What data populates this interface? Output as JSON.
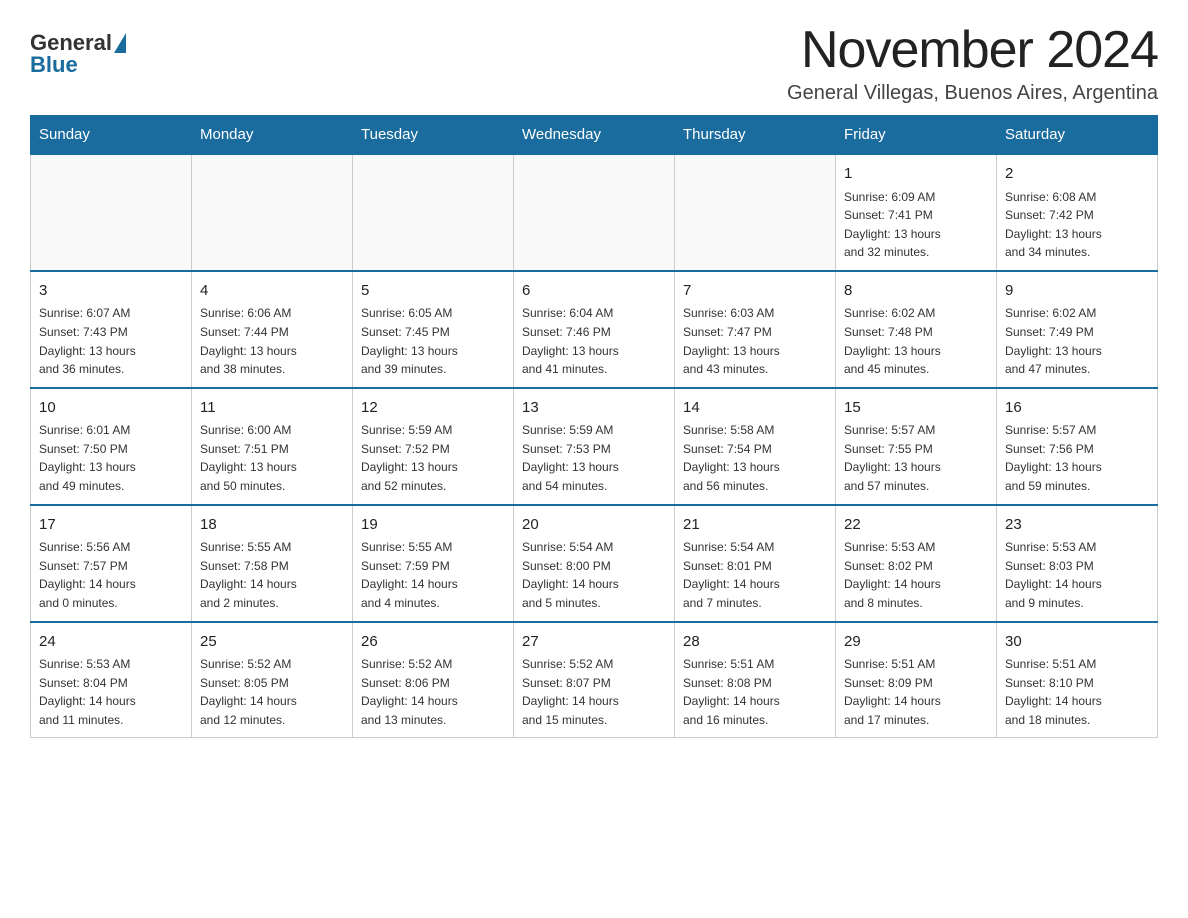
{
  "header": {
    "logo_general": "General",
    "logo_blue": "Blue",
    "main_title": "November 2024",
    "subtitle": "General Villegas, Buenos Aires, Argentina"
  },
  "days_of_week": [
    "Sunday",
    "Monday",
    "Tuesday",
    "Wednesday",
    "Thursday",
    "Friday",
    "Saturday"
  ],
  "weeks": [
    [
      {
        "day": "",
        "info": ""
      },
      {
        "day": "",
        "info": ""
      },
      {
        "day": "",
        "info": ""
      },
      {
        "day": "",
        "info": ""
      },
      {
        "day": "",
        "info": ""
      },
      {
        "day": "1",
        "info": "Sunrise: 6:09 AM\nSunset: 7:41 PM\nDaylight: 13 hours\nand 32 minutes."
      },
      {
        "day": "2",
        "info": "Sunrise: 6:08 AM\nSunset: 7:42 PM\nDaylight: 13 hours\nand 34 minutes."
      }
    ],
    [
      {
        "day": "3",
        "info": "Sunrise: 6:07 AM\nSunset: 7:43 PM\nDaylight: 13 hours\nand 36 minutes."
      },
      {
        "day": "4",
        "info": "Sunrise: 6:06 AM\nSunset: 7:44 PM\nDaylight: 13 hours\nand 38 minutes."
      },
      {
        "day": "5",
        "info": "Sunrise: 6:05 AM\nSunset: 7:45 PM\nDaylight: 13 hours\nand 39 minutes."
      },
      {
        "day": "6",
        "info": "Sunrise: 6:04 AM\nSunset: 7:46 PM\nDaylight: 13 hours\nand 41 minutes."
      },
      {
        "day": "7",
        "info": "Sunrise: 6:03 AM\nSunset: 7:47 PM\nDaylight: 13 hours\nand 43 minutes."
      },
      {
        "day": "8",
        "info": "Sunrise: 6:02 AM\nSunset: 7:48 PM\nDaylight: 13 hours\nand 45 minutes."
      },
      {
        "day": "9",
        "info": "Sunrise: 6:02 AM\nSunset: 7:49 PM\nDaylight: 13 hours\nand 47 minutes."
      }
    ],
    [
      {
        "day": "10",
        "info": "Sunrise: 6:01 AM\nSunset: 7:50 PM\nDaylight: 13 hours\nand 49 minutes."
      },
      {
        "day": "11",
        "info": "Sunrise: 6:00 AM\nSunset: 7:51 PM\nDaylight: 13 hours\nand 50 minutes."
      },
      {
        "day": "12",
        "info": "Sunrise: 5:59 AM\nSunset: 7:52 PM\nDaylight: 13 hours\nand 52 minutes."
      },
      {
        "day": "13",
        "info": "Sunrise: 5:59 AM\nSunset: 7:53 PM\nDaylight: 13 hours\nand 54 minutes."
      },
      {
        "day": "14",
        "info": "Sunrise: 5:58 AM\nSunset: 7:54 PM\nDaylight: 13 hours\nand 56 minutes."
      },
      {
        "day": "15",
        "info": "Sunrise: 5:57 AM\nSunset: 7:55 PM\nDaylight: 13 hours\nand 57 minutes."
      },
      {
        "day": "16",
        "info": "Sunrise: 5:57 AM\nSunset: 7:56 PM\nDaylight: 13 hours\nand 59 minutes."
      }
    ],
    [
      {
        "day": "17",
        "info": "Sunrise: 5:56 AM\nSunset: 7:57 PM\nDaylight: 14 hours\nand 0 minutes."
      },
      {
        "day": "18",
        "info": "Sunrise: 5:55 AM\nSunset: 7:58 PM\nDaylight: 14 hours\nand 2 minutes."
      },
      {
        "day": "19",
        "info": "Sunrise: 5:55 AM\nSunset: 7:59 PM\nDaylight: 14 hours\nand 4 minutes."
      },
      {
        "day": "20",
        "info": "Sunrise: 5:54 AM\nSunset: 8:00 PM\nDaylight: 14 hours\nand 5 minutes."
      },
      {
        "day": "21",
        "info": "Sunrise: 5:54 AM\nSunset: 8:01 PM\nDaylight: 14 hours\nand 7 minutes."
      },
      {
        "day": "22",
        "info": "Sunrise: 5:53 AM\nSunset: 8:02 PM\nDaylight: 14 hours\nand 8 minutes."
      },
      {
        "day": "23",
        "info": "Sunrise: 5:53 AM\nSunset: 8:03 PM\nDaylight: 14 hours\nand 9 minutes."
      }
    ],
    [
      {
        "day": "24",
        "info": "Sunrise: 5:53 AM\nSunset: 8:04 PM\nDaylight: 14 hours\nand 11 minutes."
      },
      {
        "day": "25",
        "info": "Sunrise: 5:52 AM\nSunset: 8:05 PM\nDaylight: 14 hours\nand 12 minutes."
      },
      {
        "day": "26",
        "info": "Sunrise: 5:52 AM\nSunset: 8:06 PM\nDaylight: 14 hours\nand 13 minutes."
      },
      {
        "day": "27",
        "info": "Sunrise: 5:52 AM\nSunset: 8:07 PM\nDaylight: 14 hours\nand 15 minutes."
      },
      {
        "day": "28",
        "info": "Sunrise: 5:51 AM\nSunset: 8:08 PM\nDaylight: 14 hours\nand 16 minutes."
      },
      {
        "day": "29",
        "info": "Sunrise: 5:51 AM\nSunset: 8:09 PM\nDaylight: 14 hours\nand 17 minutes."
      },
      {
        "day": "30",
        "info": "Sunrise: 5:51 AM\nSunset: 8:10 PM\nDaylight: 14 hours\nand 18 minutes."
      }
    ]
  ]
}
